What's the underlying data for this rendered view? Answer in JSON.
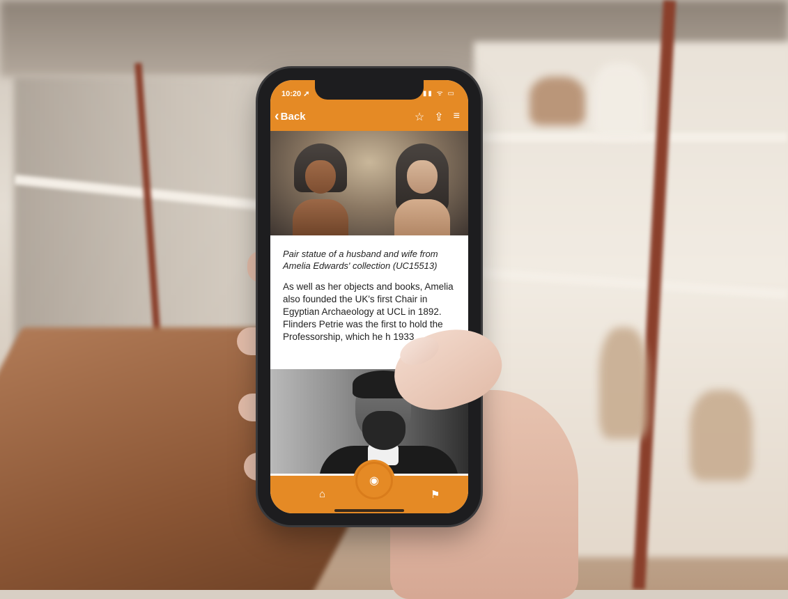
{
  "status_bar": {
    "time": "10:20 ➚",
    "icons": "▮▮ ᯤ ▭"
  },
  "nav": {
    "back_label": "Back",
    "back_icon": "‹",
    "favorite_icon": "☆",
    "share_icon": "⇪",
    "menu_icon": "≡"
  },
  "exhibit": {
    "caption": "Pair statue of a husband and wife from Amelia Edwards' collection (UC15513)",
    "body": "As well as her objects and books, Amelia also founded the UK's first Chair in Egyptian Archaeology at UCL in 1892. Flinders Petrie was the first to hold the Professorship, which he h 1933"
  },
  "tabbar": {
    "home_icon": "⌂",
    "center_icon": "◉",
    "people_icon": "⚑"
  },
  "colors": {
    "accent": "#e58a25"
  }
}
